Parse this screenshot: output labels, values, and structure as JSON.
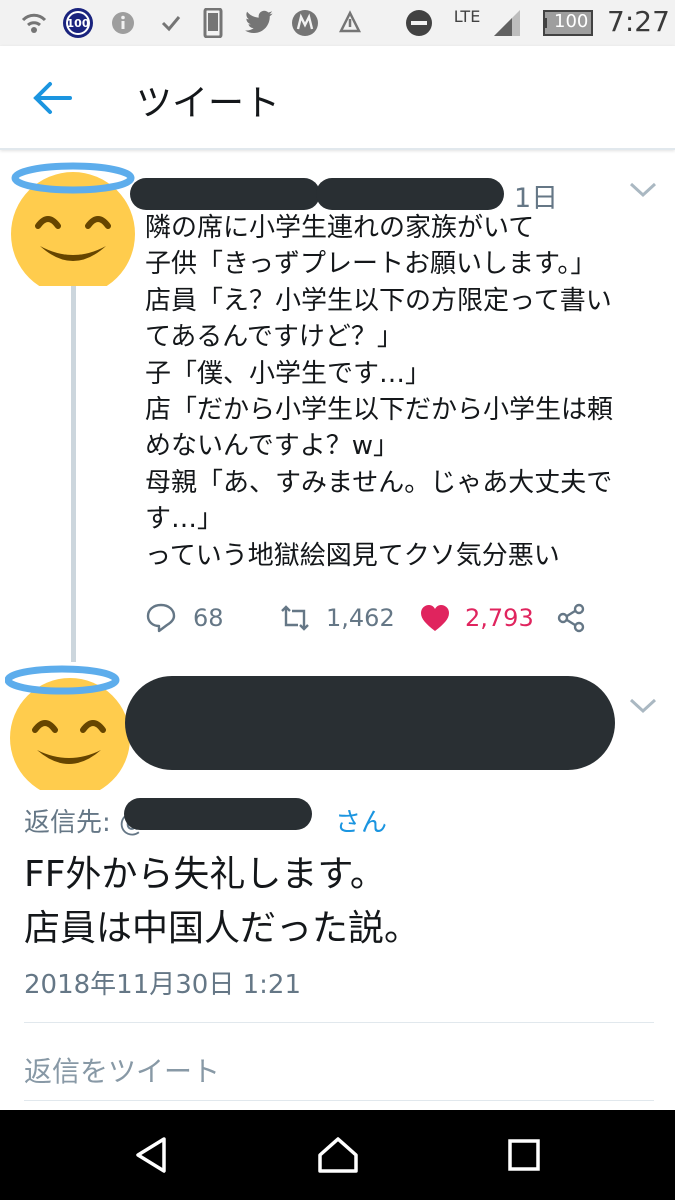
{
  "status_bar": {
    "badge": "100",
    "network": "LTE",
    "battery": "100",
    "time": "7:27",
    "icons": [
      "wifi-calling-icon",
      "notification-badge-icon",
      "info-icon",
      "check-icon",
      "phone-icon",
      "twitter-icon",
      "m-app-icon",
      "data-icon",
      "do-not-disturb-icon",
      "signal-icon",
      "battery-icon"
    ]
  },
  "header": {
    "title": "ツイート",
    "back_icon": "arrow-left-icon"
  },
  "tweet": {
    "time": "1日",
    "lines": [
      "隣の席に小学生連れの家族がいて",
      "子供「きっずプレートお願いします。」",
      "店員「え？小学生以下の方限定って書い",
      "てあるんですけど？」",
      "子「僕、小学生です…」",
      "店「だから小学生以下だから小学生は頼",
      "めないんですよ？w」",
      "母親「あ、すみません。じゃあ大丈夫で",
      "す…」",
      "っていう地獄絵図見てクソ気分悪い"
    ],
    "replies": "68",
    "retweets": "1,462",
    "likes": "2,793",
    "colors": {
      "like": "#e0245e",
      "muted": "#657786"
    }
  },
  "reply": {
    "reply_to_prefix": "返信先: @",
    "reply_to_suffix": "さん",
    "lines": [
      "FF外から失礼します。",
      "店員は中国人だった説。"
    ],
    "timestamp": "2018年11月30日 1:21"
  },
  "composer": {
    "placeholder": "返信をツイート"
  },
  "colors": {
    "accent": "#1b95e0",
    "redaction": "#292f33",
    "text": "#14171a"
  }
}
